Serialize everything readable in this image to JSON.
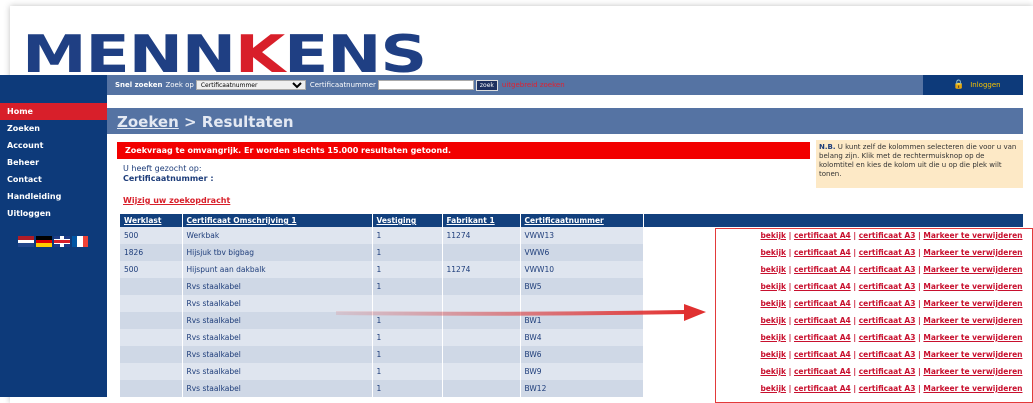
{
  "logo": {
    "part1": "MENN",
    "accent": "K",
    "part2": "ENS"
  },
  "search_bar": {
    "quick_search_label": "Snel zoeken",
    "search_on_label": "Zoek op",
    "select_value": "Certificaatnummer",
    "field_label": "Certificaatnummer",
    "input_value": "",
    "search_button": "zoek",
    "advanced_link": "uitgebreid zoeken"
  },
  "logout": {
    "label": "Inloggen"
  },
  "sidebar": {
    "items": [
      {
        "label": "Home",
        "active": true
      },
      {
        "label": "Zoeken"
      },
      {
        "label": "Account"
      },
      {
        "label": "Beheer"
      },
      {
        "label": "Contact"
      },
      {
        "label": "Handleiding"
      },
      {
        "label": "Uitloggen"
      }
    ],
    "flags": [
      "nl",
      "de",
      "uk",
      "fr"
    ]
  },
  "title": {
    "crumb": "Zoeken",
    "separator": " > ",
    "page": "Resultaten"
  },
  "warning": "Zoekvraag te omvangrijk. Er worden slechts 15.000 resultaten getoond.",
  "note": {
    "prefix": "N.B.",
    "text": " U kunt zelf de kolommen selecteren die voor u van belang zijn. Klik met de rechtermuisknop op de kolomtitel en kies de kolom uit die u op die plek wilt tonen."
  },
  "searched": {
    "label": "U heeft gezocht op:",
    "value": "Certificaatnummer :"
  },
  "change_search": "Wijzig uw zoekopdracht",
  "table": {
    "headers": [
      "Werklast",
      "Certificaat Omschrijving 1",
      "Vestiging",
      "Fabrikant 1",
      "Certificaatnummer"
    ],
    "actions": {
      "view": "bekijk",
      "a4": "certificaat A4",
      "a3": "certificaat A3",
      "mark": "Markeer te verwijderen",
      "sep": " | "
    },
    "rows": [
      [
        "500",
        "Werkbak",
        "1",
        "11274",
        "VWW13"
      ],
      [
        "1826",
        "Hijsjuk tbv bigbag",
        "1",
        "",
        "VWW6"
      ],
      [
        "500",
        "Hijspunt aan dakbalk",
        "1",
        "11274",
        "VWW10"
      ],
      [
        "",
        "Rvs staalkabel",
        "1",
        "",
        "BW5"
      ],
      [
        "",
        "Rvs staalkabel",
        "",
        "",
        ""
      ],
      [
        "",
        "Rvs staalkabel",
        "1",
        "",
        "BW1"
      ],
      [
        "",
        "Rvs staalkabel",
        "1",
        "",
        "BW4"
      ],
      [
        "",
        "Rvs staalkabel",
        "1",
        "",
        "BW6"
      ],
      [
        "",
        "Rvs staalkabel",
        "1",
        "",
        "BW9"
      ],
      [
        "",
        "Rvs staalkabel",
        "1",
        "",
        "BW12"
      ]
    ]
  },
  "colors": {
    "navy": "#0d3a7a",
    "bar_blue": "#5573a3",
    "red": "#d81f2a",
    "note_bg": "#fde9c6"
  }
}
